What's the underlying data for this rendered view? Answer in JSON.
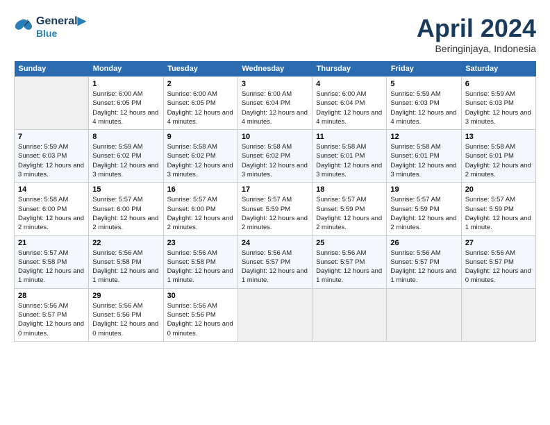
{
  "header": {
    "logo_line1": "General",
    "logo_line2": "Blue",
    "month": "April 2024",
    "location": "Beringinjaya, Indonesia"
  },
  "columns": [
    "Sunday",
    "Monday",
    "Tuesday",
    "Wednesday",
    "Thursday",
    "Friday",
    "Saturday"
  ],
  "weeks": [
    [
      {
        "day": "",
        "empty": true
      },
      {
        "day": "1",
        "sunrise": "6:00 AM",
        "sunset": "6:05 PM",
        "daylight": "12 hours and 4 minutes."
      },
      {
        "day": "2",
        "sunrise": "6:00 AM",
        "sunset": "6:05 PM",
        "daylight": "12 hours and 4 minutes."
      },
      {
        "day": "3",
        "sunrise": "6:00 AM",
        "sunset": "6:04 PM",
        "daylight": "12 hours and 4 minutes."
      },
      {
        "day": "4",
        "sunrise": "6:00 AM",
        "sunset": "6:04 PM",
        "daylight": "12 hours and 4 minutes."
      },
      {
        "day": "5",
        "sunrise": "5:59 AM",
        "sunset": "6:03 PM",
        "daylight": "12 hours and 4 minutes."
      },
      {
        "day": "6",
        "sunrise": "5:59 AM",
        "sunset": "6:03 PM",
        "daylight": "12 hours and 3 minutes."
      }
    ],
    [
      {
        "day": "7",
        "sunrise": "5:59 AM",
        "sunset": "6:03 PM",
        "daylight": "12 hours and 3 minutes."
      },
      {
        "day": "8",
        "sunrise": "5:59 AM",
        "sunset": "6:02 PM",
        "daylight": "12 hours and 3 minutes."
      },
      {
        "day": "9",
        "sunrise": "5:58 AM",
        "sunset": "6:02 PM",
        "daylight": "12 hours and 3 minutes."
      },
      {
        "day": "10",
        "sunrise": "5:58 AM",
        "sunset": "6:02 PM",
        "daylight": "12 hours and 3 minutes."
      },
      {
        "day": "11",
        "sunrise": "5:58 AM",
        "sunset": "6:01 PM",
        "daylight": "12 hours and 3 minutes."
      },
      {
        "day": "12",
        "sunrise": "5:58 AM",
        "sunset": "6:01 PM",
        "daylight": "12 hours and 3 minutes."
      },
      {
        "day": "13",
        "sunrise": "5:58 AM",
        "sunset": "6:01 PM",
        "daylight": "12 hours and 2 minutes."
      }
    ],
    [
      {
        "day": "14",
        "sunrise": "5:58 AM",
        "sunset": "6:00 PM",
        "daylight": "12 hours and 2 minutes."
      },
      {
        "day": "15",
        "sunrise": "5:57 AM",
        "sunset": "6:00 PM",
        "daylight": "12 hours and 2 minutes."
      },
      {
        "day": "16",
        "sunrise": "5:57 AM",
        "sunset": "6:00 PM",
        "daylight": "12 hours and 2 minutes."
      },
      {
        "day": "17",
        "sunrise": "5:57 AM",
        "sunset": "5:59 PM",
        "daylight": "12 hours and 2 minutes."
      },
      {
        "day": "18",
        "sunrise": "5:57 AM",
        "sunset": "5:59 PM",
        "daylight": "12 hours and 2 minutes."
      },
      {
        "day": "19",
        "sunrise": "5:57 AM",
        "sunset": "5:59 PM",
        "daylight": "12 hours and 2 minutes."
      },
      {
        "day": "20",
        "sunrise": "5:57 AM",
        "sunset": "5:59 PM",
        "daylight": "12 hours and 1 minute."
      }
    ],
    [
      {
        "day": "21",
        "sunrise": "5:57 AM",
        "sunset": "5:58 PM",
        "daylight": "12 hours and 1 minute."
      },
      {
        "day": "22",
        "sunrise": "5:56 AM",
        "sunset": "5:58 PM",
        "daylight": "12 hours and 1 minute."
      },
      {
        "day": "23",
        "sunrise": "5:56 AM",
        "sunset": "5:58 PM",
        "daylight": "12 hours and 1 minute."
      },
      {
        "day": "24",
        "sunrise": "5:56 AM",
        "sunset": "5:57 PM",
        "daylight": "12 hours and 1 minute."
      },
      {
        "day": "25",
        "sunrise": "5:56 AM",
        "sunset": "5:57 PM",
        "daylight": "12 hours and 1 minute."
      },
      {
        "day": "26",
        "sunrise": "5:56 AM",
        "sunset": "5:57 PM",
        "daylight": "12 hours and 1 minute."
      },
      {
        "day": "27",
        "sunrise": "5:56 AM",
        "sunset": "5:57 PM",
        "daylight": "12 hours and 0 minutes."
      }
    ],
    [
      {
        "day": "28",
        "sunrise": "5:56 AM",
        "sunset": "5:57 PM",
        "daylight": "12 hours and 0 minutes."
      },
      {
        "day": "29",
        "sunrise": "5:56 AM",
        "sunset": "5:56 PM",
        "daylight": "12 hours and 0 minutes."
      },
      {
        "day": "30",
        "sunrise": "5:56 AM",
        "sunset": "5:56 PM",
        "daylight": "12 hours and 0 minutes."
      },
      {
        "day": "",
        "empty": true
      },
      {
        "day": "",
        "empty": true
      },
      {
        "day": "",
        "empty": true
      },
      {
        "day": "",
        "empty": true
      }
    ]
  ]
}
